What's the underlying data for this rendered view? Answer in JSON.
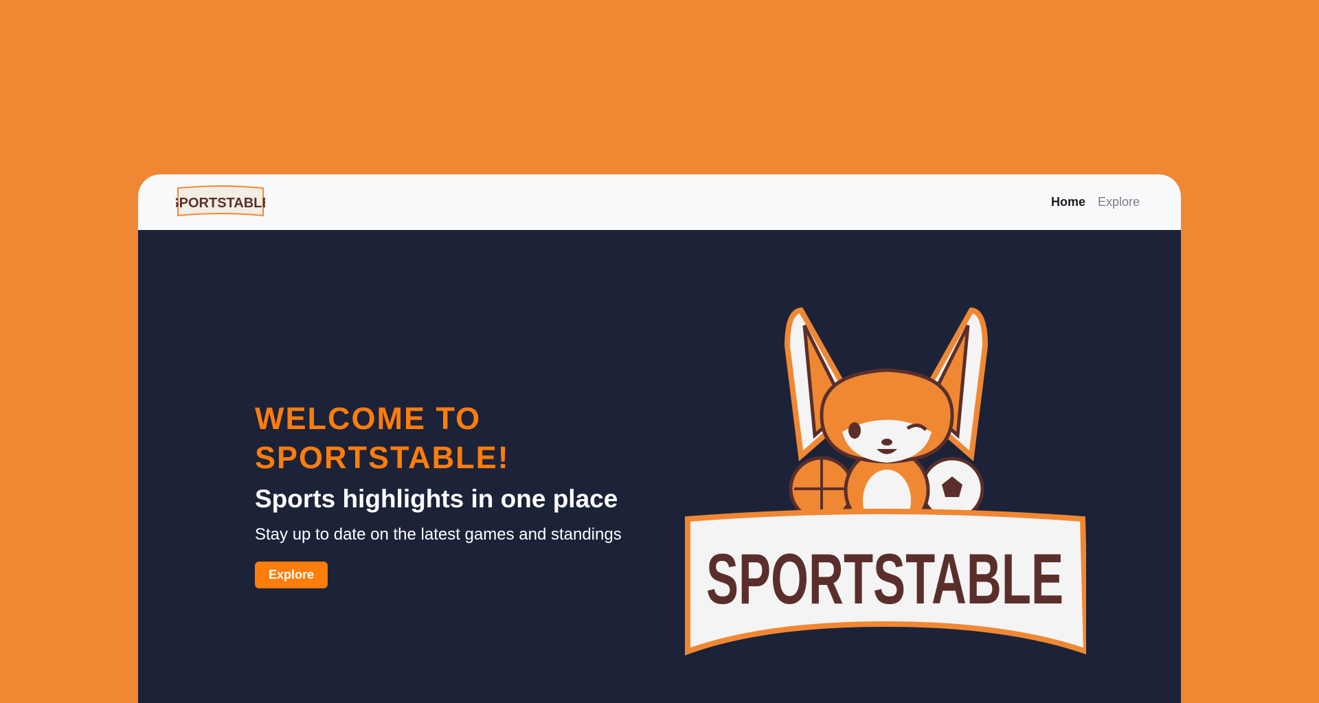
{
  "brand": {
    "logo_text": "SPORTSTABLE",
    "primary_color": "#ff7d0a",
    "background_color": "#f08833",
    "hero_background": "#1c2238",
    "logo_brown": "#5a2f2b"
  },
  "nav": {
    "items": [
      {
        "label": "Home",
        "active": true
      },
      {
        "label": "Explore",
        "active": false
      }
    ]
  },
  "hero": {
    "heading": "WELCOME TO SPORTSTABLE!",
    "subheading": "Sports highlights in one place",
    "description": "Stay up to date on the latest games and standings",
    "button_label": "Explore"
  },
  "mascot": {
    "banner_text": "SPORTSTABLE",
    "icon": "fox-mascot-icon"
  }
}
